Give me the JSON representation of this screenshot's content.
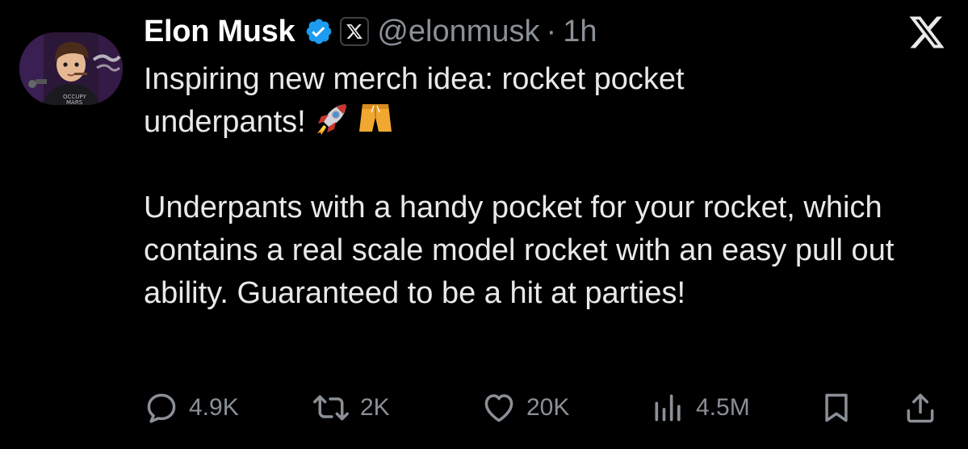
{
  "author": {
    "name": "Elon Musk",
    "handle": "@elonmusk",
    "separator": "·",
    "time": "1h",
    "avatar_text": "OCCUPY MARS"
  },
  "icons": {
    "verified": "verified-badge-icon",
    "affiliate": "x-affiliate-icon",
    "platform_logo": "x-logo-icon",
    "reply": "reply-icon",
    "repost": "repost-icon",
    "like": "heart-icon",
    "views": "views-icon",
    "bookmark": "bookmark-icon",
    "share": "share-icon",
    "emoji_1": "rocket-emoji",
    "emoji_2": "shorts-emoji"
  },
  "tweet": {
    "line1": "Inspiring new merch idea: rocket pocket",
    "line2": "underpants!",
    "paragraph2": "Underpants with a handy pocket for your rocket, which contains a real scale model rocket with an easy pull out ability. Guaranteed to be a hit at parties!"
  },
  "stats": {
    "replies": "4.9K",
    "reposts": "2K",
    "likes": "20K",
    "views": "4.5M"
  },
  "colors": {
    "background": "#000000",
    "text": "#e7e9ea",
    "secondary": "#8b9096",
    "verified_blue": "#1d9bf0"
  }
}
